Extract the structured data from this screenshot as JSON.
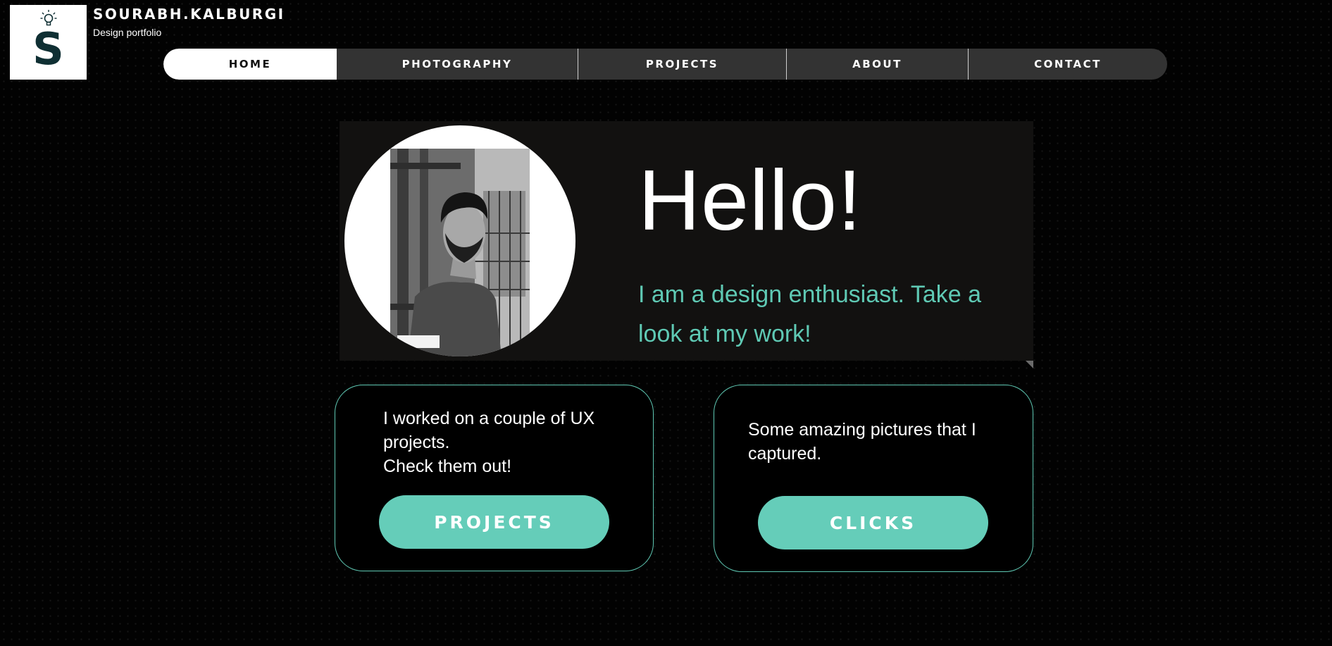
{
  "header": {
    "logo_letter": "S",
    "title": "SOURABH.KALBURGI",
    "subtitle": "Design portfolio"
  },
  "nav": {
    "items": [
      {
        "label": "HOME",
        "active": true
      },
      {
        "label": "PHOTOGRAPHY",
        "active": false
      },
      {
        "label": "PROJECTS",
        "active": false
      },
      {
        "label": "ABOUT",
        "active": false
      },
      {
        "label": "CONTACT",
        "active": false
      }
    ]
  },
  "hero": {
    "greeting": "Hello!",
    "tagline": "I am a design enthusiast. Take a look at my work!"
  },
  "cards": {
    "projects": {
      "line1": "I worked on a couple of UX projects.",
      "line2": "Check them out!",
      "button_label": "PROJECTS"
    },
    "clicks": {
      "text": "Some amazing pictures that I captured.",
      "button_label": "CLICKS"
    }
  },
  "colors": {
    "accent": "#65cdb9",
    "tagline": "#5fc9b4",
    "nav_bg": "#333333",
    "logo_letter": "#0f2f33"
  }
}
